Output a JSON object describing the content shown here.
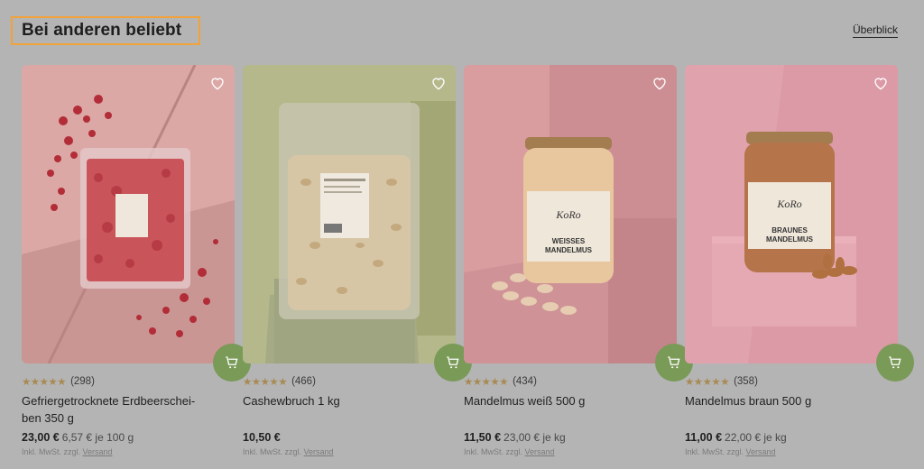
{
  "section": {
    "title": "Bei anderen beliebt",
    "overview_link": "Überblick"
  },
  "colors": {
    "background": "#b4b4b4",
    "highlight_border": "#f2a23a",
    "cart_button": "#7a9a58",
    "stars": "#a88a52"
  },
  "icons": {
    "wishlist": "heart-outline-icon",
    "cart": "shopping-cart-icon",
    "rating": "star-icon"
  },
  "products": [
    {
      "stars": "★★★★★",
      "rating_value": 4.5,
      "review_count": "(298)",
      "name": "Gefriergetrocknete Erdbeerschei-ben 350 g",
      "price": "23,00 €",
      "unit_price": "6,57 € je 100 g",
      "vat_text": "Inkl. MwSt. zzgl.",
      "shipping_link": "Versand"
    },
    {
      "stars": "★★★★★",
      "rating_value": 4.5,
      "review_count": "(466)",
      "name": "Cashewbruch 1 kg",
      "price": "10,50 €",
      "unit_price": "",
      "vat_text": "Inkl. MwSt. zzgl.",
      "shipping_link": "Versand"
    },
    {
      "stars": "★★★★★",
      "rating_value": 4.5,
      "review_count": "(434)",
      "name": "Mandelmus weiß 500 g",
      "price": "11,50 €",
      "unit_price": "23,00 € je kg",
      "vat_text": "Inkl. MwSt. zzgl.",
      "shipping_link": "Versand",
      "jar_label_brand": "KoRo",
      "jar_label_line1": "WEISSES",
      "jar_label_line2": "MANDELMUS"
    },
    {
      "stars": "★★★★★",
      "rating_value": 4.5,
      "review_count": "(358)",
      "name": "Mandelmus braun 500 g",
      "price": "11,00 €",
      "unit_price": "22,00 € je kg",
      "vat_text": "Inkl. MwSt. zzgl.",
      "shipping_link": "Versand",
      "jar_label_brand": "KoRo",
      "jar_label_line1": "BRAUNES",
      "jar_label_line2": "MANDELMUS"
    }
  ]
}
